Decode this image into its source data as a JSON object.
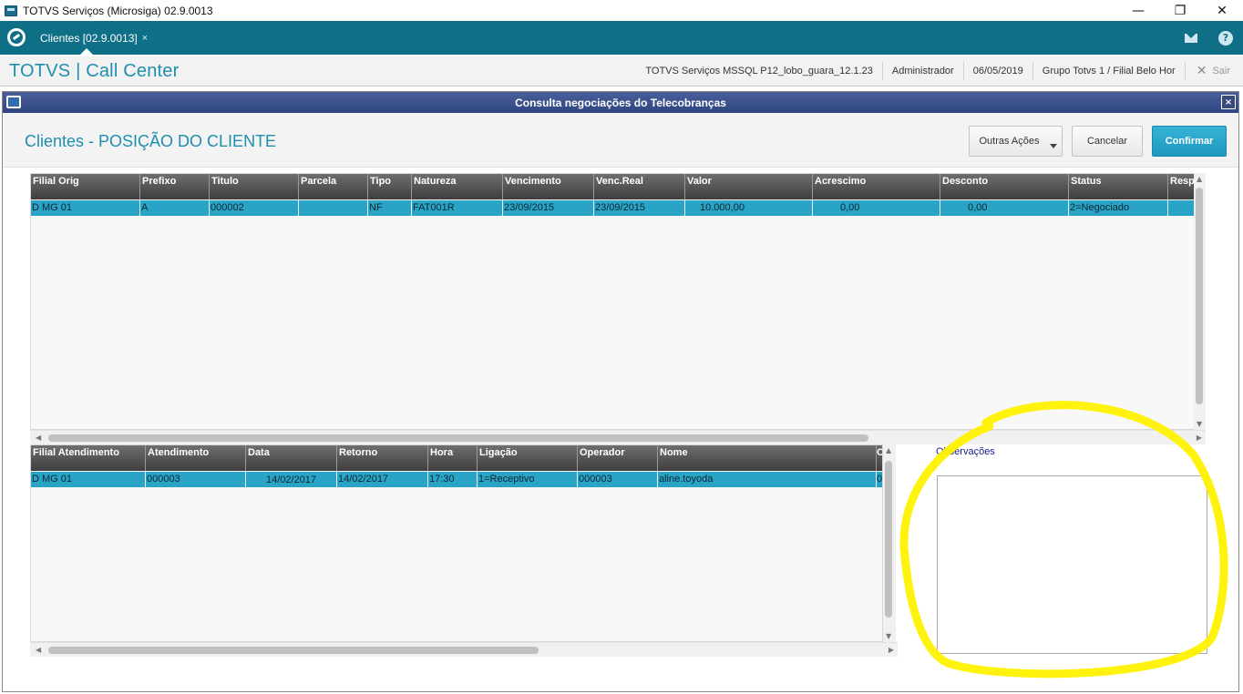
{
  "window": {
    "title": "TOTVS Serviços (Microsiga) 02.9.0013",
    "controls": {
      "minimize": "—",
      "maximize": "❐",
      "close": "✕"
    }
  },
  "tabbar": {
    "active_tab": "Clientes [02.9.0013]",
    "tab_close": "×"
  },
  "header": {
    "brand": "TOTVS | Call Center",
    "environment": "TOTVS Serviços MSSQL P12_lobo_guara_12.1.23",
    "user": "Administrador",
    "date": "06/05/2019",
    "branch": "Grupo Totvs 1 / Filial Belo Hor",
    "exit_label": "Sair",
    "exit_icon": "✕"
  },
  "dialog": {
    "title": "Consulta negociações do Telecobranças",
    "close": "×",
    "heading": "Clientes - POSIÇÃO DO CLIENTE",
    "buttons": {
      "more_actions": "Outras Ações",
      "cancel": "Cancelar",
      "confirm": "Confirmar"
    }
  },
  "titles_grid": {
    "columns": [
      "Filial Orig",
      "Prefixo",
      "Titulo",
      "Parcela",
      "Tipo",
      "Natureza",
      "Vencimento",
      "Venc.Real",
      "Valor",
      "Acrescimo",
      "Desconto",
      "Status",
      "Resp"
    ],
    "rows": [
      [
        "D MG 01",
        "A",
        "000002",
        "",
        "NF",
        "FAT001R",
        "23/09/2015",
        "23/09/2015",
        "10.000,00",
        "0,00",
        "0,00",
        "2=Negociado",
        ""
      ]
    ]
  },
  "calls_grid": {
    "columns": [
      "Filial Atendimento",
      "Atendimento",
      "Data",
      "Retorno",
      "Hora",
      "Ligação",
      "Operador",
      "Nome",
      "C"
    ],
    "rows": [
      [
        "D MG 01",
        "000003",
        "14/02/2017",
        "14/02/2017",
        "17:30",
        "1=Receptivo",
        "000003",
        "aline.toyoda",
        "0"
      ]
    ]
  },
  "observations": {
    "label": "Observações",
    "value": ""
  },
  "colors": {
    "tabbar": "#0e6f86",
    "brand": "#1f8fb0",
    "row_selected": "#2aa4c6",
    "dialog_title": "#2f4582",
    "highlight": "#fff200"
  },
  "icons": {
    "app": "app-window-icon",
    "logo": "totvs-logo-icon",
    "mail": "mail-icon",
    "help": "help-icon"
  }
}
